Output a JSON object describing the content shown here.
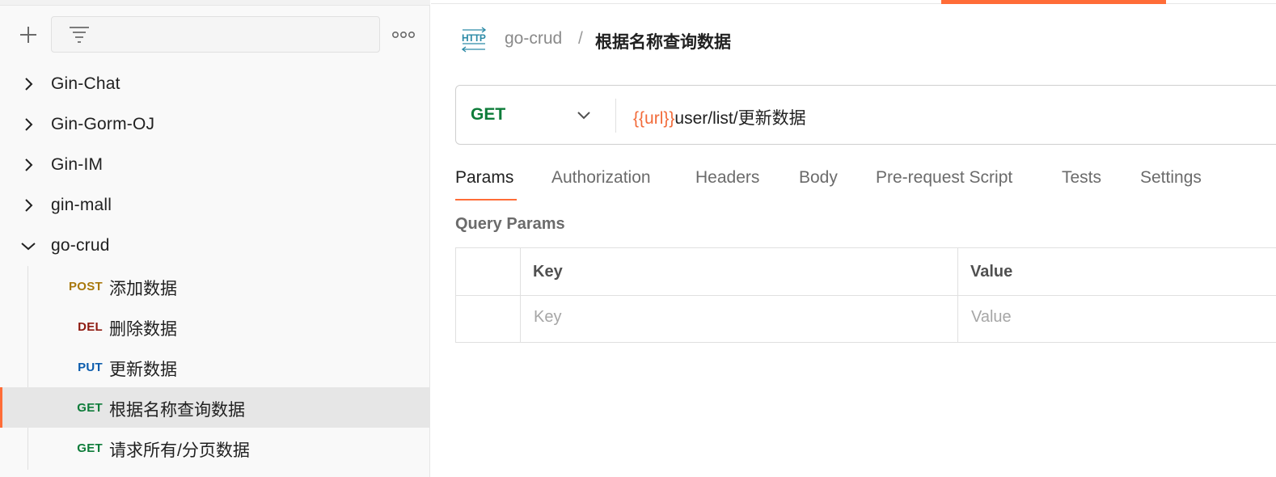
{
  "sidebar": {
    "collections": [
      {
        "label": "Gin-Chat",
        "expanded": false
      },
      {
        "label": "Gin-Gorm-OJ",
        "expanded": false
      },
      {
        "label": "Gin-IM",
        "expanded": false
      },
      {
        "label": "gin-mall",
        "expanded": false
      },
      {
        "label": "go-crud",
        "expanded": true
      }
    ],
    "requests": [
      {
        "method": "POST",
        "name": "添加数据",
        "method_color": "#a8780b",
        "active": false
      },
      {
        "method": "DEL",
        "name": "删除数据",
        "method_color": "#8e1a10",
        "active": false
      },
      {
        "method": "PUT",
        "name": "更新数据",
        "method_color": "#0b5cad",
        "active": false
      },
      {
        "method": "GET",
        "name": "根据名称查询数据",
        "method_color": "#0e7c3a",
        "active": true
      },
      {
        "method": "GET",
        "name": "请求所有/分页数据",
        "method_color": "#0e7c3a",
        "active": false
      }
    ],
    "icons": {
      "add": "plus-icon",
      "filter": "filter-icon",
      "more": "more-horizontal-icon"
    }
  },
  "main": {
    "breadcrumb": {
      "icon": "http-icon",
      "parent": "go-crud",
      "separator": "/",
      "title": "根据名称查询数据"
    },
    "request": {
      "method": "GET",
      "url_variable": "{{url}}",
      "url_path": "user/list/更新数据"
    },
    "tabs": [
      {
        "label": "Params",
        "active": true
      },
      {
        "label": "Authorization",
        "active": false
      },
      {
        "label": "Headers",
        "active": false
      },
      {
        "label": "Body",
        "active": false
      },
      {
        "label": "Pre-request Script",
        "active": false
      },
      {
        "label": "Tests",
        "active": false
      },
      {
        "label": "Settings",
        "active": false
      }
    ],
    "query_params": {
      "title": "Query Params",
      "columns": [
        "Key",
        "Value"
      ],
      "placeholders": {
        "key": "Key",
        "value": "Value"
      }
    }
  },
  "colors": {
    "accent": "#ff6c37",
    "get": "#0e7c3a",
    "post": "#a8780b",
    "delete": "#8e1a10",
    "put": "#0b5cad",
    "url_variable": "#f26b3a"
  }
}
